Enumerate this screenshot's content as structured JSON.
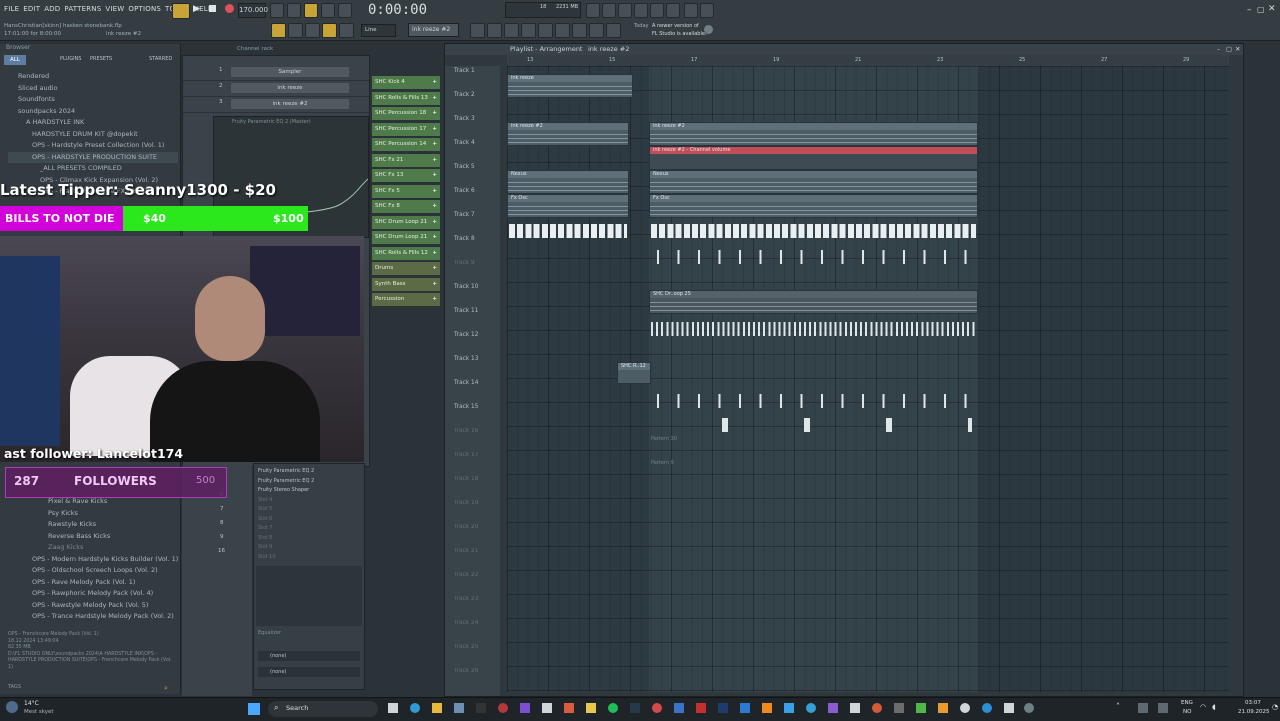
{
  "menu": [
    "FILE",
    "EDIT",
    "ADD",
    "PATTERNS",
    "VIEW",
    "OPTIONS",
    "TOOLS",
    "HELP"
  ],
  "project": {
    "name": "HansChristian[skinn] hasken stonebank.flp",
    "time_info": "17:01:00 for 8:00:00",
    "pattern": "ink reeze #2"
  },
  "transport": {
    "tempo": "170.000",
    "time": "0:00:00",
    "cpu": "18",
    "memory": "2231 MB",
    "pattern_selector": "ink reeze #2",
    "snap": "Line"
  },
  "news": {
    "date": "Today",
    "line1": "A newer version of",
    "line2": "FL Studio is available!"
  },
  "browser": {
    "tabs": [
      "ALL",
      "PLUGINS",
      "PRESETS",
      "STARRED"
    ],
    "title": "Browser",
    "items": [
      "Rendered",
      "Sliced audio",
      "Soundfonts",
      "soundpacks 2024",
      "A HARDSTYLE INK",
      "HARDSTYLE DRUM KIT @dopekit",
      "OPS - Hardstyle Preset Collection (Vol. 1)",
      "OPS - HARDSTYLE PRODUCTION SUITE",
      "_ALL PRESETS COMPILED",
      "OPS - Climax Kick Expansion (Vol. 2)",
      "OPS - Fractal Hardstyle FX (Vol. 2)"
    ],
    "items_lower": [
      "Pixel & Rave Kicks",
      "Psy Kicks",
      "Rawstyle Kicks",
      "Reverse Bass Kicks",
      "Zaag Kicks",
      "OPS - Modern Hardstyle Kicks Builder (Vol. 1)",
      "OPS - Oldschool Screech Loops (Vol. 2)",
      "OPS - Rave Melody Pack (Vol. 1)",
      "OPS - Rawphoric Melody Pack (Vol. 4)",
      "OPS - Rawstyle Melody Pack (Vol. 5)",
      "OPS - Trance Hardstyle Melody Pack (Vol. 2)"
    ],
    "info": {
      "title": "OPS - Frenchcore Melody Pack (Vol. 1)",
      "date": "18.12.2024 13:49:04",
      "size": "82.35 MB",
      "path": "D:\\FL STUDIO ONLY\\soundpacks 2024\\A HARDSTYLE INK\\OPS - HARDSTYLE PRODUCTION SUITE\\OPS - Frenchcore Melody Pack (Vol. 1)"
    },
    "tags_label": "TAGS"
  },
  "rack": {
    "title": "Channel rack",
    "rows": [
      {
        "num": "1",
        "name": "Sampler"
      },
      {
        "num": "2",
        "name": "ink reeze"
      },
      {
        "num": "3",
        "name": "ink reeze #2"
      }
    ],
    "lower_nums": [
      "6",
      "7",
      "8",
      "9",
      "16"
    ],
    "plugin": "Fruity Parametric EQ 2 (Master)"
  },
  "mixer": {
    "slots": [
      "Fruity Parametric EQ 2",
      "Fruity Parametric EQ 2",
      "Fruity Stereo Shaper",
      "Slot 4",
      "Slot 5",
      "Slot 6",
      "Slot 7",
      "Slot 8",
      "Slot 9",
      "Slot 10"
    ],
    "equalizer": "Equalizer",
    "routes": [
      "(none)",
      "(none)"
    ]
  },
  "patterns": [
    "SHC Kick 4",
    "SHC Rolls & Fills 13",
    "SHC Percussion 18",
    "SHC Percussion 17",
    "SHC Percussion 14",
    "SHC Fx 21",
    "SHC Fx 13",
    "SHC Fx 5",
    "SHC Fx 8",
    "SHC Drum Loop 21",
    "SHC Drum Loop 21",
    "SHC Rolls & Fills 12",
    "Drums",
    "Synth Bass",
    "Percussion"
  ],
  "playlist": {
    "title": "Playlist - Arrangement",
    "pattern": "ink reeze #2",
    "bars": [
      "13",
      "15",
      "17",
      "19",
      "21",
      "23",
      "25",
      "27",
      "29"
    ],
    "tracks": [
      "Track 1",
      "Track 2",
      "Track 3",
      "Track 4",
      "Track 5",
      "Track 6",
      "Track 7",
      "Track 8",
      "Track 9",
      "Track 10",
      "Track 11",
      "Track 12",
      "Track 13",
      "Track 14",
      "Track 15",
      "Track 16",
      "Track 17",
      "Track 18",
      "Track 19",
      "Track 20",
      "Track 21",
      "Track 22",
      "Track 23",
      "Track 24",
      "Track 25",
      "Track 26"
    ],
    "clips": {
      "ink_reeze": "ink reeze",
      "ink_reeze_2": "ink reeze #2",
      "channel_volume": "ink reeze #2 - Channel volume",
      "nexus": "Nexus",
      "fx_osc": "Fx Osc",
      "shc_loop": "SHC Dr..oop 25",
      "shc_short": "SHC R..12",
      "pattern_30": "Pattern 30",
      "pattern_9": "Pattern 9"
    }
  },
  "overlay": {
    "tipper": "Latest Tipper: Seanny1300 - $20",
    "goal_label": "BILLS TO NOT DIE",
    "goal_current": "$40",
    "goal_target": "$100",
    "follower": "ast follower: Lancelot174",
    "followers_count": "287",
    "followers_label": "FOLLOWERS",
    "followers_goal": "500"
  },
  "taskbar": {
    "weather_temp": "14°C",
    "weather_desc": "Mest skyet",
    "search": "Search",
    "lang": "ENG",
    "region": "NO",
    "time": "03:07",
    "date": "21.09.2025"
  }
}
